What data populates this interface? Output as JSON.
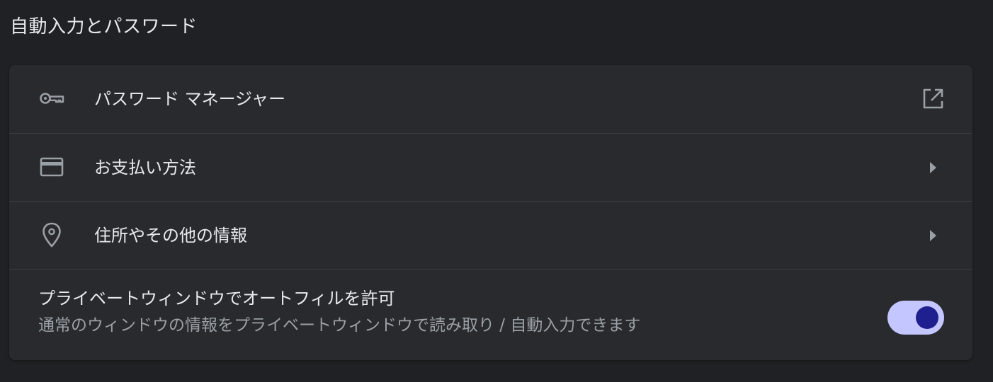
{
  "section": {
    "title": "自動入力とパスワード"
  },
  "items": [
    {
      "label": "パスワード マネージャー",
      "icon": "key-icon",
      "trailing": "open-in-new-icon"
    },
    {
      "label": "お支払い方法",
      "icon": "credit-card-icon",
      "trailing": "chevron-right-icon"
    },
    {
      "label": "住所やその他の情報",
      "icon": "location-pin-icon",
      "trailing": "chevron-right-icon"
    }
  ],
  "private_autofill": {
    "label": "プライベートウィンドウでオートフィルを許可",
    "description": "通常のウィンドウの情報をプライベートウィンドウで読み取り / 自動入力できます",
    "enabled": true
  },
  "colors": {
    "background": "#202124",
    "card": "#292a2d",
    "divider": "#3c4043",
    "text_primary": "#e8eaed",
    "text_secondary": "#9aa0a6",
    "icon": "#9aa0a6",
    "toggle_track": "#c4c7ff",
    "toggle_knob": "#1f1f8f"
  }
}
